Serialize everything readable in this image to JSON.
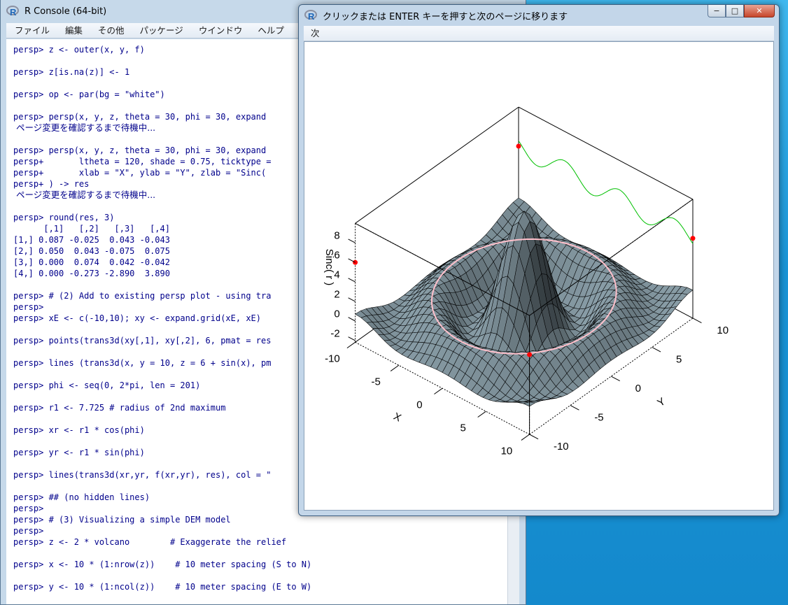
{
  "console": {
    "title": "R Console (64-bit)",
    "menu": [
      "ファイル",
      "編集",
      "その他",
      "パッケージ",
      "ウインドウ",
      "ヘルプ"
    ],
    "lines": [
      "persp> z <- outer(x, y, f)",
      "",
      "persp> z[is.na(z)] <- 1",
      "",
      "persp> op <- par(bg = \"white\")",
      "",
      "persp> persp(x, y, z, theta = 30, phi = 30, expand",
      " ページ変更を確認するまで待機中...",
      "",
      "persp> persp(x, y, z, theta = 30, phi = 30, expand",
      "persp+       ltheta = 120, shade = 0.75, ticktype =",
      "persp+       xlab = \"X\", ylab = \"Y\", zlab = \"Sinc(",
      "persp+ ) -> res",
      " ページ変更を確認するまで待機中...",
      "",
      "persp> round(res, 3)",
      "      [,1]   [,2]   [,3]   [,4]",
      "[1,] 0.087 -0.025  0.043 -0.043",
      "[2,] 0.050  0.043 -0.075  0.075",
      "[3,] 0.000  0.074  0.042 -0.042",
      "[4,] 0.000 -0.273 -2.890  3.890",
      "",
      "persp> # (2) Add to existing persp plot - using tra",
      "persp>",
      "persp> xE <- c(-10,10); xy <- expand.grid(xE, xE)",
      "",
      "persp> points(trans3d(xy[,1], xy[,2], 6, pmat = res",
      "",
      "persp> lines (trans3d(x, y = 10, z = 6 + sin(x), pm",
      "",
      "persp> phi <- seq(0, 2*pi, len = 201)",
      "",
      "persp> r1 <- 7.725 # radius of 2nd maximum",
      "",
      "persp> xr <- r1 * cos(phi)",
      "",
      "persp> yr <- r1 * sin(phi)",
      "",
      "persp> lines(trans3d(xr,yr, f(xr,yr), res), col = \"",
      "",
      "persp> ## (no hidden lines)",
      "persp>",
      "persp> # (3) Visualizing a simple DEM model",
      "persp>",
      "persp> z <- 2 * volcano        # Exaggerate the relief",
      "",
      "persp> x <- 10 * (1:nrow(z))    # 10 meter spacing (S to N)",
      "",
      "persp> y <- 10 * (1:ncol(z))    # 10 meter spacing (E to W)"
    ]
  },
  "graphics": {
    "title": "クリックまたは ENTER キーを押すと次のページに移ります",
    "menu": [
      "次"
    ],
    "buttons": {
      "minimize": "−",
      "maximize": "□",
      "close": "✕"
    }
  },
  "plot": {
    "xlab": "X",
    "ylab": "Y",
    "zlab": "Sinc( r )",
    "x_ticks": [
      "-10",
      "-5",
      "0",
      "5",
      "10"
    ],
    "y_ticks": [
      "-10",
      "-5",
      "0",
      "5",
      "10"
    ],
    "z_ticks": [
      "-2",
      "0",
      "2",
      "4",
      "6",
      "8"
    ],
    "surface_color": "#8ea3ad",
    "ring_color": "#ffc0cb",
    "wave_color": "#00c000",
    "point_color": "#ff0000"
  }
}
